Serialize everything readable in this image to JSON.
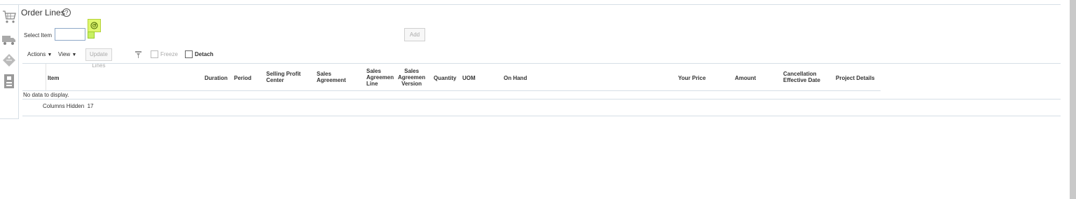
{
  "header": {
    "title": "Order Lines",
    "help_glyph": "?"
  },
  "select_item": {
    "label": "Select Item",
    "value": ""
  },
  "add_button": {
    "label": "Add"
  },
  "toolbar": {
    "actions": "Actions",
    "view": "View",
    "update_lines": "Update Lines",
    "freeze": "Freeze",
    "detach": "Detach",
    "dropdown_glyph": "▼"
  },
  "table": {
    "columns": [
      {
        "lines": [
          "Item"
        ]
      },
      {
        "lines": [
          "Duration"
        ]
      },
      {
        "lines": [
          "Period"
        ]
      },
      {
        "lines": [
          "Selling Profit",
          "Center"
        ]
      },
      {
        "lines": [
          "Sales",
          "Agreement"
        ]
      },
      {
        "lines": [
          "Sales",
          "Agreemen",
          "Line"
        ]
      },
      {
        "lines": [
          "Sales",
          "Agreemen",
          "Version"
        ]
      },
      {
        "lines": [
          "Quantity"
        ]
      },
      {
        "lines": [
          "UOM"
        ]
      },
      {
        "lines": [
          "On Hand"
        ]
      },
      {
        "lines": [
          "Your Price"
        ]
      },
      {
        "lines": [
          "Amount"
        ]
      },
      {
        "lines": [
          "Cancellation",
          "Effective Date"
        ]
      },
      {
        "lines": [
          "Project Details"
        ]
      }
    ],
    "empty_message": "No data to display.",
    "columns_hidden_label": "Columns Hidden",
    "columns_hidden_count": "17"
  },
  "icons": [
    "cart-icon",
    "truck-icon",
    "tag-icon",
    "document-icon",
    "help-icon",
    "lookup-icon",
    "badge-icon",
    "filter-icon",
    "freeze-icon",
    "detach-icon"
  ],
  "colors": {
    "border": "#d6dfe6",
    "badge": "#dff76e",
    "accent": "#8fa9c8"
  }
}
